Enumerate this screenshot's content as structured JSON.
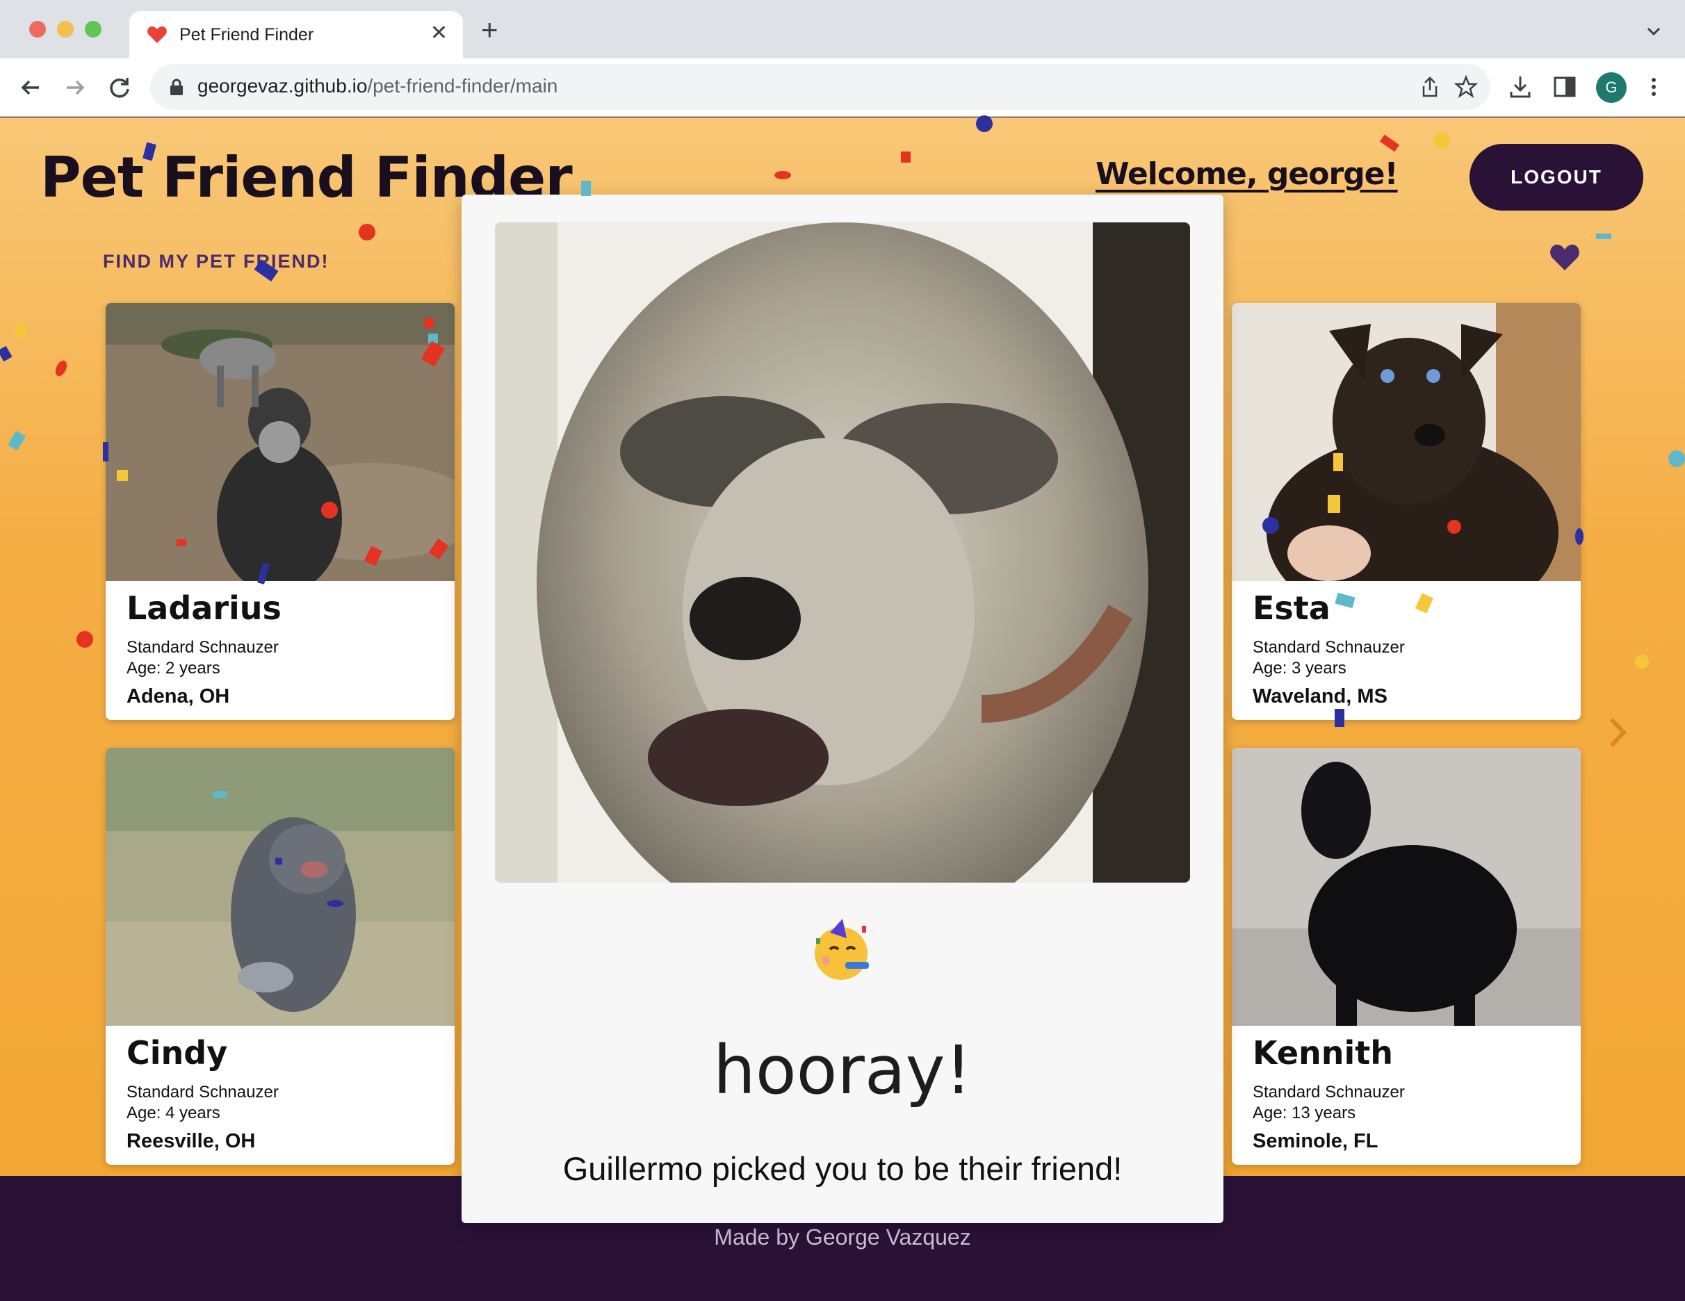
{
  "browser": {
    "tab_title": "Pet Friend Finder",
    "url_host": "georgevaz.github.io",
    "url_path": "/pet-friend-finder/main",
    "avatar_letter": "G",
    "icons": [
      "back-icon",
      "forward-icon",
      "reload-icon",
      "lock-icon",
      "share-icon",
      "star-icon",
      "download-icon",
      "sidebar-icon",
      "menu-icon"
    ]
  },
  "header": {
    "site_title": "Pet Friend Finder",
    "welcome": "Welcome, george!",
    "logout_label": "LOGOUT"
  },
  "main": {
    "section_label": "FIND MY PET FRIEND!",
    "pets": [
      {
        "name": "Ladarius",
        "breed": "Standard Schnauzer",
        "age": "Age: 2 years",
        "location": "Adena, OH"
      },
      {
        "name": "Esta",
        "breed": "Standard Schnauzer",
        "age": "Age: 3 years",
        "location": "Waveland, MS"
      },
      {
        "name": "Cindy",
        "breed": "Standard Schnauzer",
        "age": "Age: 4 years",
        "location": "Reesville, OH"
      },
      {
        "name": "Kennith",
        "breed": "Standard Schnauzer",
        "age": "Age: 13 years",
        "location": "Seminole, FL"
      }
    ]
  },
  "modal": {
    "heading": "hooray!",
    "message": "Guillermo picked you to be their friend!",
    "emoji": "partying-face-icon"
  },
  "footer": {
    "text": "Made by George Vazquez"
  },
  "colors": {
    "page_gradient_top": "#f8c777",
    "page_gradient_bottom": "#f2a634",
    "dark_purple": "#2a1236",
    "label_purple": "#4b2a6e"
  }
}
